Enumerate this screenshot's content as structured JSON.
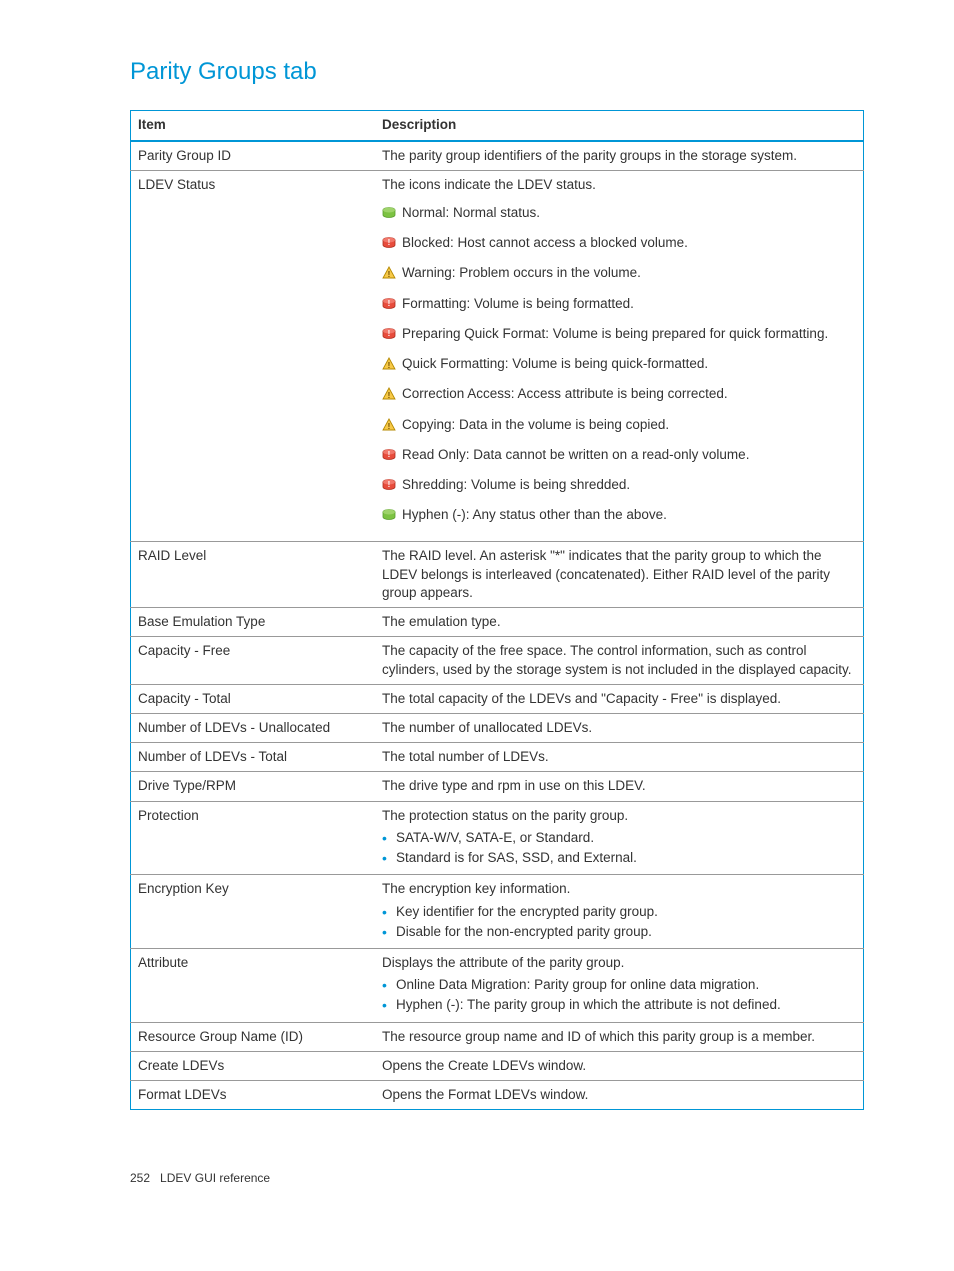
{
  "title": "Parity Groups tab",
  "headers": {
    "item": "Item",
    "description": "Description"
  },
  "rows": {
    "parityGroupId": {
      "item": "Parity Group ID",
      "desc": "The parity group identifiers of the parity groups in the storage system."
    },
    "ldevStatus": {
      "item": "LDEV Status",
      "intro": "The icons indicate the LDEV status.",
      "statuses": [
        {
          "icon": "green-cyl",
          "text": "Normal: Normal status."
        },
        {
          "icon": "red-cyl",
          "text": "Blocked: Host cannot access a blocked volume."
        },
        {
          "icon": "warn",
          "text": "Warning: Problem occurs in the volume."
        },
        {
          "icon": "red-cyl",
          "text": "Formatting: Volume is being formatted."
        },
        {
          "icon": "red-cyl",
          "text": "Preparing Quick Format: Volume is being prepared for quick formatting."
        },
        {
          "icon": "warn",
          "text": "Quick Formatting: Volume is being quick-formatted."
        },
        {
          "icon": "warn",
          "text": "Correction Access: Access attribute is being corrected."
        },
        {
          "icon": "warn",
          "text": "Copying: Data in the volume is being copied."
        },
        {
          "icon": "red-cyl",
          "text": "Read Only: Data cannot be written on a read-only volume."
        },
        {
          "icon": "red-cyl",
          "text": "Shredding: Volume is being shredded."
        },
        {
          "icon": "green-cyl",
          "text": "Hyphen (-): Any status other than the above."
        }
      ]
    },
    "raidLevel": {
      "item": "RAID Level",
      "desc": "The RAID level. An asterisk \"*\" indicates that the parity group to which the LDEV belongs is interleaved (concatenated). Either RAID level of the parity group appears."
    },
    "baseEmu": {
      "item": "Base Emulation Type",
      "desc": "The emulation type."
    },
    "capFree": {
      "item": "Capacity - Free",
      "desc": "The capacity of the free space. The control information, such as control cylinders, used by the storage system is not included in the displayed capacity."
    },
    "capTotal": {
      "item": "Capacity - Total",
      "desc": "The total capacity of the LDEVs and \"Capacity - Free\" is displayed."
    },
    "numUnalloc": {
      "item": "Number of LDEVs - Unallocated",
      "desc": "The number of unallocated LDEVs."
    },
    "numTotal": {
      "item": "Number of LDEVs - Total",
      "desc": "The total number of LDEVs."
    },
    "driveType": {
      "item": "Drive Type/RPM",
      "desc": "The drive type and rpm in use on this LDEV."
    },
    "protection": {
      "item": "Protection",
      "intro": "The protection status on the parity group.",
      "bullets": [
        "SATA-W/V, SATA-E, or Standard.",
        "Standard is for SAS, SSD, and External."
      ]
    },
    "encKey": {
      "item": "Encryption Key",
      "intro": "The encryption key information.",
      "bullets": [
        "Key identifier for the encrypted parity group.",
        "Disable for the non-encrypted parity group."
      ]
    },
    "attribute": {
      "item": "Attribute",
      "intro": "Displays the attribute of the parity group.",
      "bullets": [
        "Online Data Migration: Parity group for online data migration.",
        "Hyphen (-): The parity group in which the attribute is not defined."
      ]
    },
    "resGroup": {
      "item": "Resource Group Name (ID)",
      "desc": "The resource group name and ID of which this parity group is a member."
    },
    "createLdev": {
      "item": "Create LDEVs",
      "desc": "Opens the Create LDEVs window."
    },
    "formatLdev": {
      "item": "Format LDEVs",
      "desc": "Opens the Format LDEVs window."
    }
  },
  "footer": {
    "page": "252",
    "section": "LDEV GUI reference"
  }
}
